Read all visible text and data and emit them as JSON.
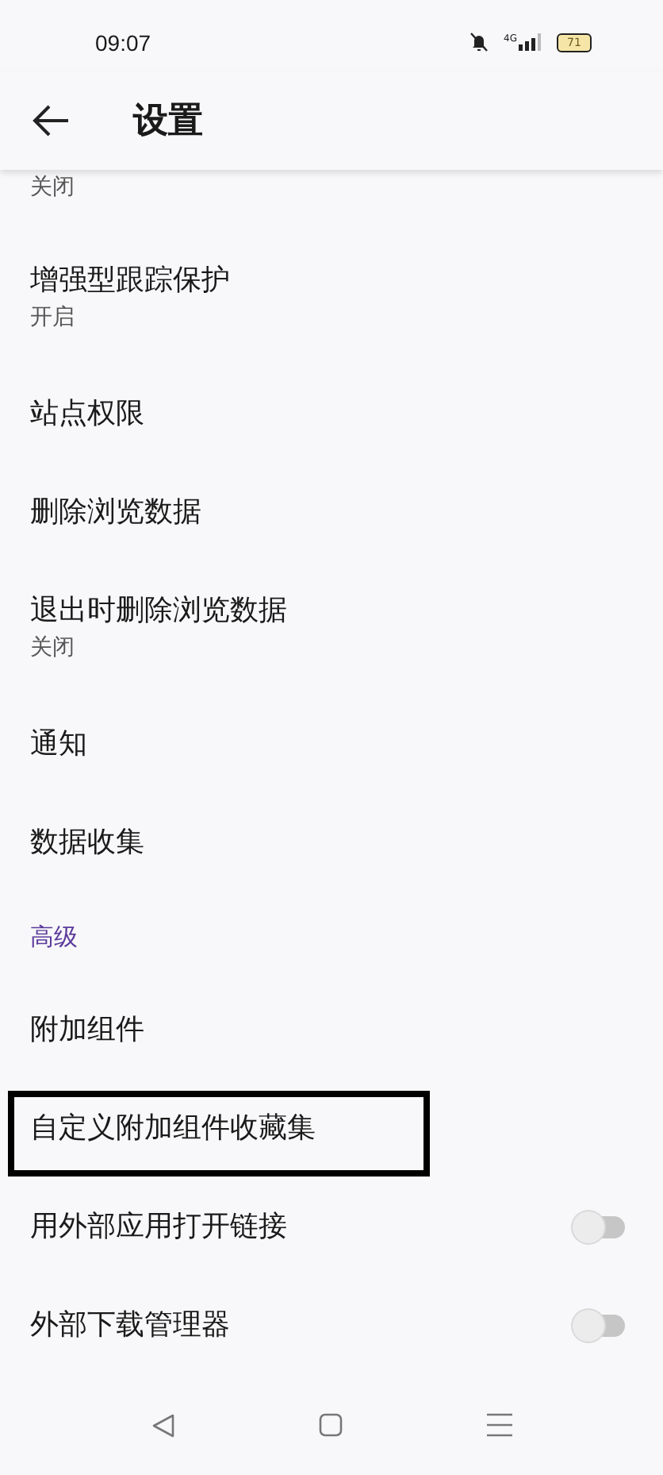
{
  "status_bar": {
    "time": "09:07",
    "network": "4G",
    "battery": "71"
  },
  "header": {
    "title": "设置"
  },
  "items": [
    {
      "kind": "item",
      "subtitle": "关闭"
    },
    {
      "kind": "item",
      "title": "增强型跟踪保护",
      "subtitle": "开启"
    },
    {
      "kind": "item",
      "title": "站点权限"
    },
    {
      "kind": "item",
      "title": "删除浏览数据"
    },
    {
      "kind": "item",
      "title": "退出时删除浏览数据",
      "subtitle": "关闭"
    },
    {
      "kind": "item",
      "title": "通知"
    },
    {
      "kind": "item",
      "title": "数据收集"
    },
    {
      "kind": "section",
      "title": "高级"
    },
    {
      "kind": "item",
      "title": "附加组件"
    },
    {
      "kind": "item",
      "title": "自定义附加组件收藏集",
      "framed": true
    },
    {
      "kind": "toggle",
      "title": "用外部应用打开链接",
      "on": false
    },
    {
      "kind": "toggle",
      "title": "外部下载管理器",
      "on": false
    }
  ]
}
